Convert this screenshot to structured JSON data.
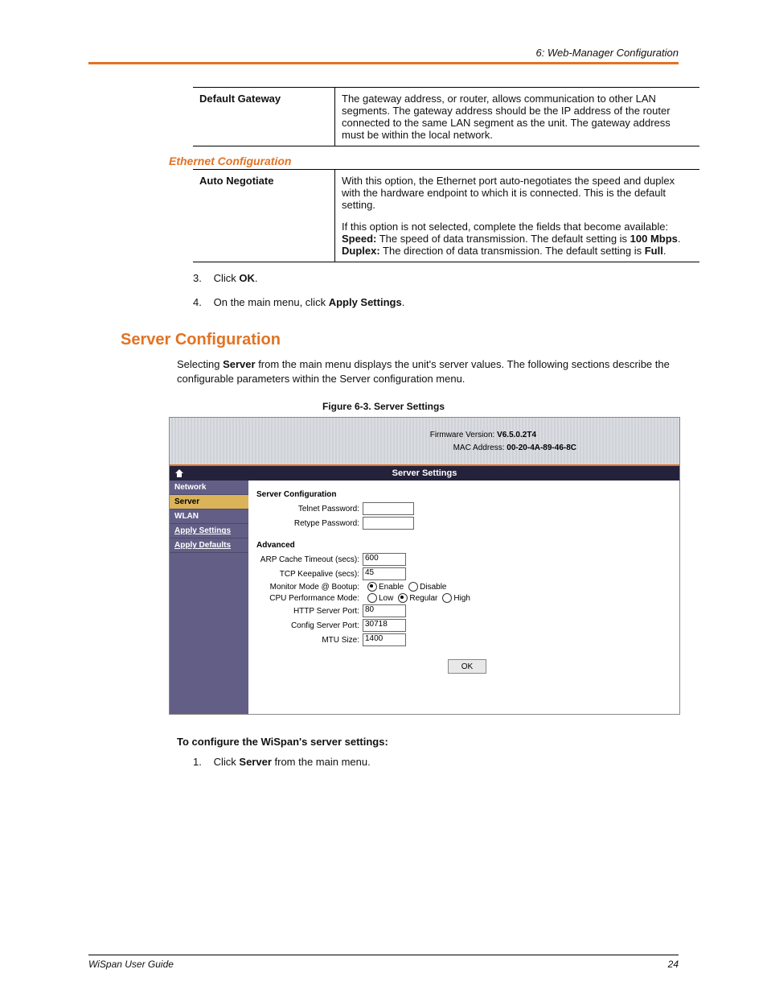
{
  "header": {
    "chapter": "6: Web-Manager Configuration"
  },
  "table1": {
    "rows": [
      {
        "label": "Default Gateway",
        "text": "The gateway address, or router, allows communication to other LAN segments. The gateway address should be the IP address of the router connected to the same LAN segment as the unit. The gateway address must be within the local network."
      }
    ]
  },
  "section_sub": "Ethernet Configuration",
  "table2": {
    "label": "Auto Negotiate",
    "p1": "With this option, the Ethernet port auto-negotiates the speed and duplex with the hardware endpoint to which it is connected. This is the default setting.",
    "p2": "If this option is not selected, complete the fields that become available:",
    "speed_label": "Speed:",
    "speed_text": " The speed of data transmission. The default setting is ",
    "speed_val": "100 Mbps",
    "duplex_label": "Duplex:",
    "duplex_text": " The direction of data transmission. The default setting is ",
    "duplex_val": "Full"
  },
  "steps_a": {
    "s3_num": "3.",
    "s3_pre": "Click ",
    "s3_bold": "OK",
    "s3_post": ".",
    "s4_num": "4.",
    "s4_pre": "On the main menu, click ",
    "s4_bold": "Apply Settings",
    "s4_post": "."
  },
  "h2": "Server Configuration",
  "intro": {
    "pre": "Selecting ",
    "bold": "Server",
    "post": " from the main menu displays the unit's server values. The following sections describe the configurable parameters within the Server configuration menu."
  },
  "figcap": "Figure 6-3. Server Settings",
  "screenshot": {
    "fw_label": "Firmware Version: ",
    "fw_value": "V6.5.0.2T4",
    "mac_label": "MAC Address: ",
    "mac_value": "00-20-4A-89-46-8C",
    "title": "Server Settings",
    "menu": [
      "Network",
      "Server",
      "WLAN",
      "Apply Settings",
      "Apply Defaults"
    ],
    "selected_index": 1,
    "section1": "Server Configuration",
    "fields1": [
      {
        "label": "Telnet Password:",
        "value": ""
      },
      {
        "label": "Retype Password:",
        "value": ""
      }
    ],
    "section2": "Advanced",
    "arp_label": "ARP Cache Timeout (secs):",
    "arp_value": "600",
    "tcp_label": "TCP Keepalive (secs):",
    "tcp_value": "45",
    "monitor_label": "Monitor Mode @ Bootup:",
    "monitor_opts": [
      "Enable",
      "Disable"
    ],
    "monitor_sel": 0,
    "cpu_label": "CPU Performance Mode:",
    "cpu_opts": [
      "Low",
      "Regular",
      "High"
    ],
    "cpu_sel": 1,
    "http_label": "HTTP Server Port:",
    "http_value": "80",
    "config_label": "Config Server Port:",
    "config_value": "30718",
    "mtu_label": "MTU Size:",
    "mtu_value": "1400",
    "ok_label": "OK"
  },
  "subhead": "To configure the WiSpan's server settings:",
  "steps_b": {
    "s1_num": "1.",
    "s1_pre": "Click ",
    "s1_bold": "Server",
    "s1_post": " from the main menu."
  },
  "footer": {
    "left": "WiSpan User Guide",
    "right": "24"
  }
}
